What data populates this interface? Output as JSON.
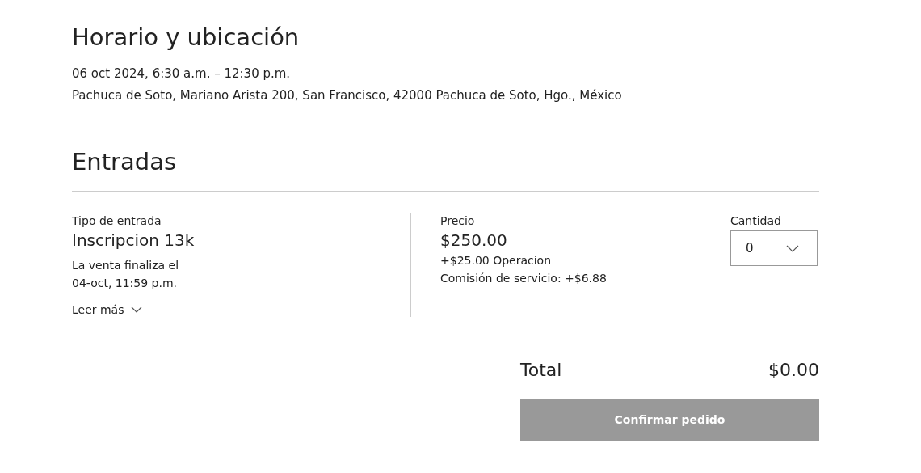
{
  "schedule": {
    "heading": "Horario y ubicación",
    "datetime": "06 oct 2024, 6:30 a.m. – 12:30 p.m.",
    "address": "Pachuca de Soto, Mariano Arista 200, San Francisco, 42000 Pachuca de Soto, Hgo., México"
  },
  "tickets": {
    "heading": "Entradas",
    "items": [
      {
        "type_label": "Tipo de entrada",
        "name": "Inscripcion 13k",
        "sale_end": [
          "La venta finaliza el",
          "04-oct, 11:59 p.m."
        ],
        "read_more": "Leer más",
        "price_label": "Precio",
        "price": "$250.00",
        "fees": [
          "+$25.00 Operacion",
          "Comisión de servicio: +$6.88"
        ],
        "quantity_label": "Cantidad",
        "quantity": "0"
      }
    ]
  },
  "total": {
    "label": "Total",
    "value": "$0.00"
  },
  "confirm_button": {
    "label": "Confirmar pedido",
    "disabled": true
  }
}
